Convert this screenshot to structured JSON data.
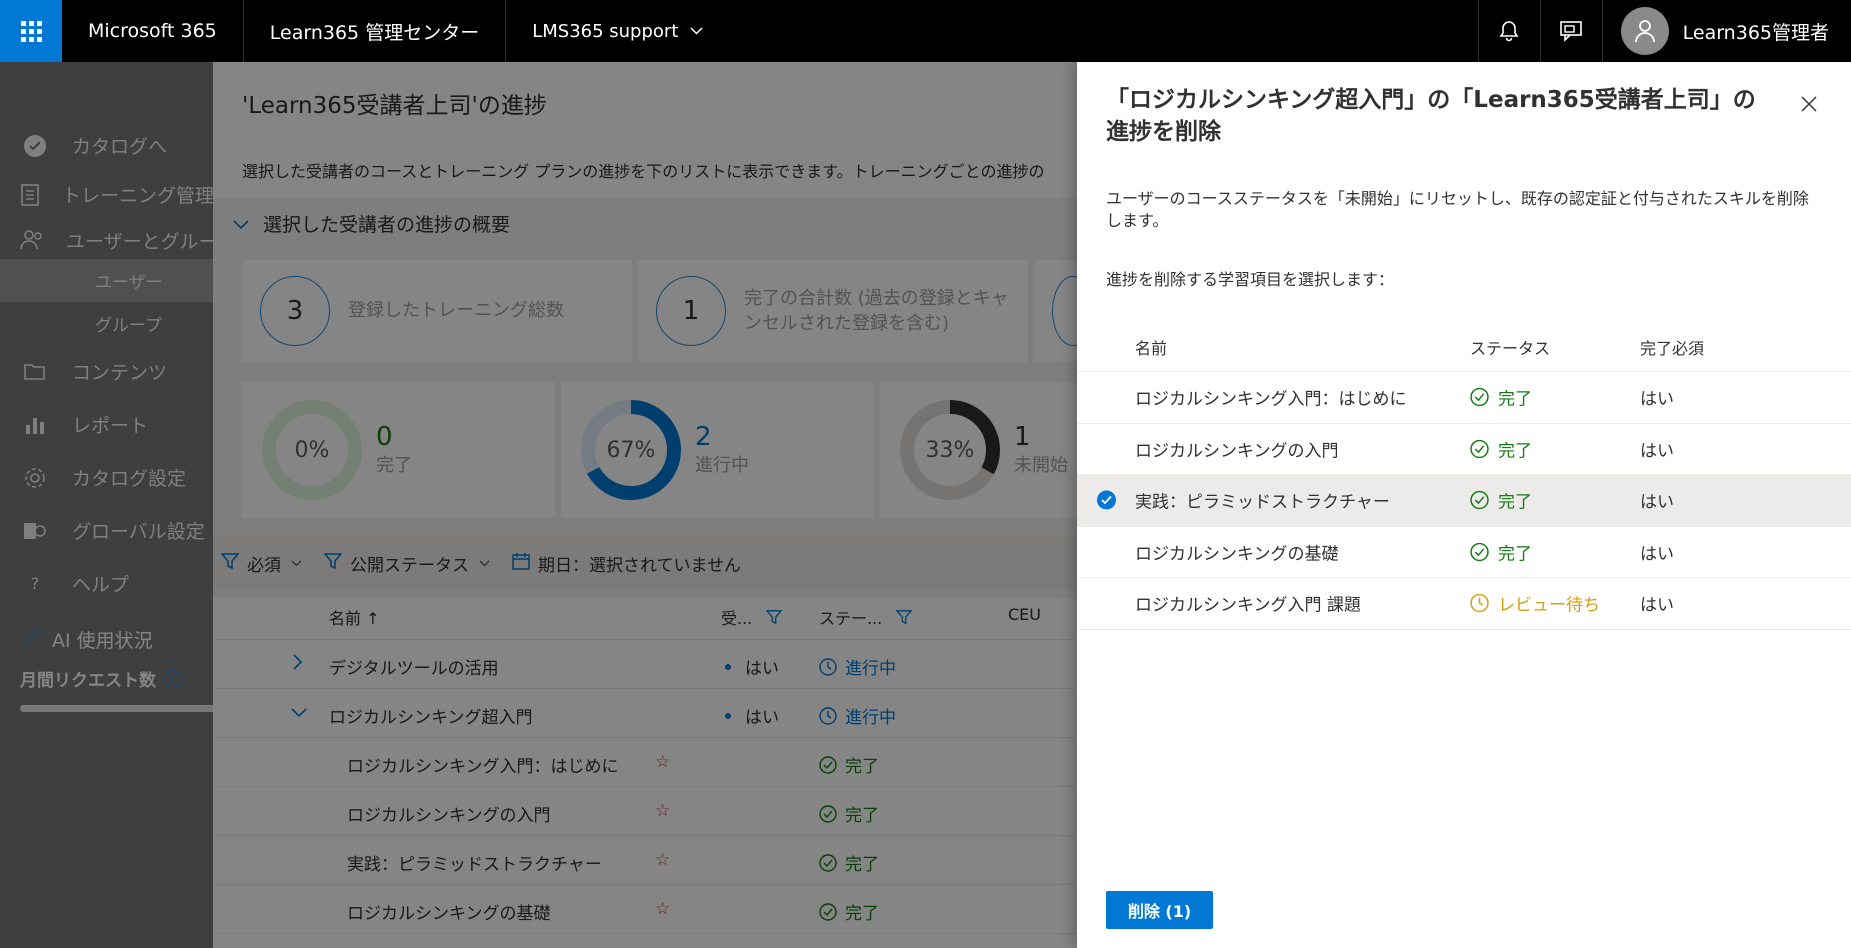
{
  "topbar": {
    "brand": "Microsoft 365",
    "app": "Learn365 管理センター",
    "tenant": "LMS365 support",
    "user_name": "Learn365管理者"
  },
  "sidebar": {
    "items": [
      {
        "label": "カタログへ",
        "icon": "check-circle-icon"
      },
      {
        "label": "トレーニング管理",
        "icon": "training-icon"
      },
      {
        "label": "ユーザーとグループ",
        "icon": "people-icon"
      },
      {
        "label": "ユーザー",
        "sub": true,
        "active": true
      },
      {
        "label": "グループ",
        "sub": true
      },
      {
        "label": "コンテンツ",
        "icon": "folder-icon"
      },
      {
        "label": "レポート",
        "icon": "chart-icon"
      },
      {
        "label": "カタログ設定",
        "icon": "gear-icon"
      },
      {
        "label": "グローバル設定",
        "icon": "global-settings-icon"
      },
      {
        "label": "ヘルプ",
        "icon": "help-icon"
      }
    ],
    "ai_title": "AI 使用状況",
    "ai_monthly": "月間リクエスト数"
  },
  "main": {
    "title": "'Learn365受講者上司'の進捗",
    "description": "選択した受講者のコースとトレーニング プランの進捗を下のリストに表示できます。トレーニングごとの進捗の",
    "summary_heading": "選択した受講者の進捗の概要",
    "cards": [
      {
        "number": "3",
        "label": "登録したトレーニング総数"
      },
      {
        "number": "1",
        "label": "完了の合計数 (過去の登録とキャンセルされた登録を含む)"
      }
    ],
    "donuts": [
      {
        "pct": "0%",
        "count": "0",
        "label": "完了",
        "fraction": 0,
        "color": "#dff6dd",
        "fill": "#107c10"
      },
      {
        "pct": "67%",
        "count": "2",
        "label": "進行中",
        "fraction": 0.67,
        "color": "#deecf9",
        "fill": "#0078d4"
      },
      {
        "pct": "33%",
        "count": "1",
        "label": "未開始",
        "fraction": 0.33,
        "color": "#e1dfdd",
        "fill": "#323130"
      }
    ],
    "filters": {
      "required": "必須",
      "publish_status": "公開ステータス",
      "due_date": "期日：選択されていません"
    },
    "table_headers": {
      "name": "名前 ↑",
      "required": "受...",
      "status": "ステー...",
      "ceu": "CEU"
    },
    "rows": [
      {
        "name": "デジタルツールの活用",
        "required": "はい",
        "status": "進行中",
        "expand": ">"
      },
      {
        "name": "ロジカルシンキング超入門",
        "required": "はい",
        "status": "進行中",
        "expand": "v"
      },
      {
        "name": "ロジカルシンキング入門：はじめに",
        "star": "☆",
        "status": "完了"
      },
      {
        "name": "ロジカルシンキングの入門",
        "star": "☆",
        "status": "完了"
      },
      {
        "name": "実践：ピラミッドストラクチャー",
        "star": "☆",
        "status": "完了"
      },
      {
        "name": "ロジカルシンキングの基礎",
        "star": "☆",
        "status": "完了"
      }
    ]
  },
  "panel": {
    "title": "「ロジカルシンキング超入門」の「Learn365受講者上司」の進捗を削除",
    "description": "ユーザーのコースステータスを「未開始」にリセットし、既存の認定証と付与されたスキルを削除します。",
    "prompt": "進捗を削除する学習項目を選択します：",
    "headers": {
      "name": "名前",
      "status": "ステータス",
      "required": "完了必須"
    },
    "items": [
      {
        "name": "ロジカルシンキング入門：はじめに",
        "status": "完了",
        "required": "はい",
        "selected": false,
        "kind": "ok"
      },
      {
        "name": "ロジカルシンキングの入門",
        "status": "完了",
        "required": "はい",
        "selected": false,
        "kind": "ok"
      },
      {
        "name": "実践：ピラミッドストラクチャー",
        "status": "完了",
        "required": "はい",
        "selected": true,
        "kind": "ok"
      },
      {
        "name": "ロジカルシンキングの基礎",
        "status": "完了",
        "required": "はい",
        "selected": false,
        "kind": "ok"
      },
      {
        "name": "ロジカルシンキング入門 課題",
        "status": "レビュー待ち",
        "required": "はい",
        "selected": false,
        "kind": "wait"
      }
    ],
    "delete_label": "削除 (1)"
  }
}
